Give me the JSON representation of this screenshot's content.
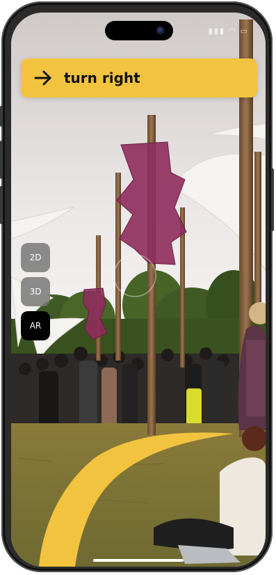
{
  "navigation": {
    "instruction": "turn right",
    "direction_icon": "arrow-right-icon"
  },
  "view_modes": {
    "items": [
      {
        "label": "2D",
        "active": false
      },
      {
        "label": "3D",
        "active": false
      },
      {
        "label": "AR",
        "active": true
      }
    ]
  },
  "colors": {
    "accent": "#F2C33E",
    "active_mode": "#000000",
    "inactive_mode": "#787878"
  }
}
